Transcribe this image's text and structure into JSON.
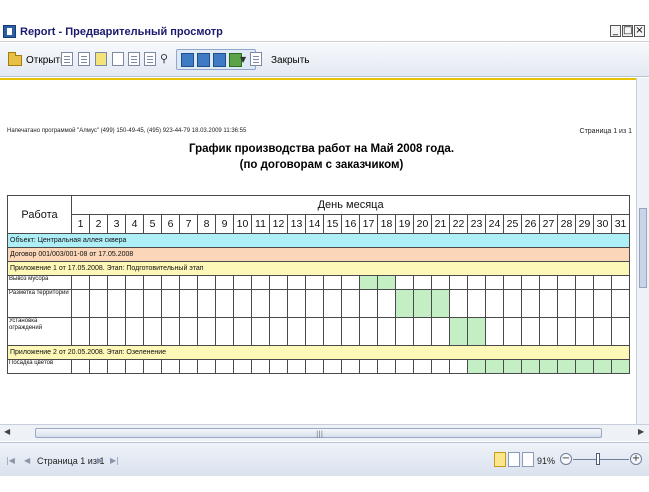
{
  "window": {
    "title": "Report - Предварительный просмотр"
  },
  "toolbar": {
    "open_label": "Открыть",
    "close_label": "Закрыть"
  },
  "report": {
    "printed_by": "Напечатано программой \"Алмус\" (499) 150-49-45, (495) 923-44-79 18.03.2009 11:36:55",
    "page_info": "Страница 1 из 1",
    "title_line1": "График производства работ на Май 2008 года.",
    "title_line2": "(по договорам с заказчиком)",
    "col_work": "Работа",
    "col_days": "День месяца",
    "days": [
      "1",
      "2",
      "3",
      "4",
      "5",
      "6",
      "7",
      "8",
      "9",
      "10",
      "11",
      "12",
      "13",
      "14",
      "15",
      "16",
      "17",
      "18",
      "19",
      "20",
      "21",
      "22",
      "23",
      "24",
      "25",
      "26",
      "27",
      "28",
      "29",
      "30",
      "31"
    ],
    "rows": [
      {
        "kind": "object",
        "text": "Объект: Центральная аллея сквера",
        "color": "#aeeef6"
      },
      {
        "kind": "contract",
        "text": "Договор 001/003/001-08 от 17.05.2008",
        "color": "#fbd6b8"
      },
      {
        "kind": "appendix",
        "text": "Приложение 1 от 17.05.2008. Этап: Подготовительный этап",
        "color": "#fdf7b8"
      },
      {
        "kind": "task",
        "name": "Вывоз мусора",
        "active": [
          17,
          18
        ],
        "tall": false
      },
      {
        "kind": "task",
        "name": "Разметка территории",
        "active": [
          19,
          20,
          21
        ],
        "tall": true
      },
      {
        "kind": "task",
        "name": "Установка ограждений",
        "active": [
          22,
          23
        ],
        "tall": true
      },
      {
        "kind": "appendix",
        "text": "Приложение 2 от 20.05.2008. Этап: Озеленение",
        "color": "#fdf7b8"
      },
      {
        "kind": "task",
        "name": "Посадка цветов",
        "active": [
          23,
          24,
          25,
          26,
          27,
          28,
          29,
          30,
          31
        ],
        "tall": false
      }
    ]
  },
  "statusbar": {
    "page_text": "Страница 1 из 1",
    "zoom": "91%"
  },
  "colors": {
    "accent_line": "#e6c200",
    "active_cell": "#c4efc4"
  }
}
